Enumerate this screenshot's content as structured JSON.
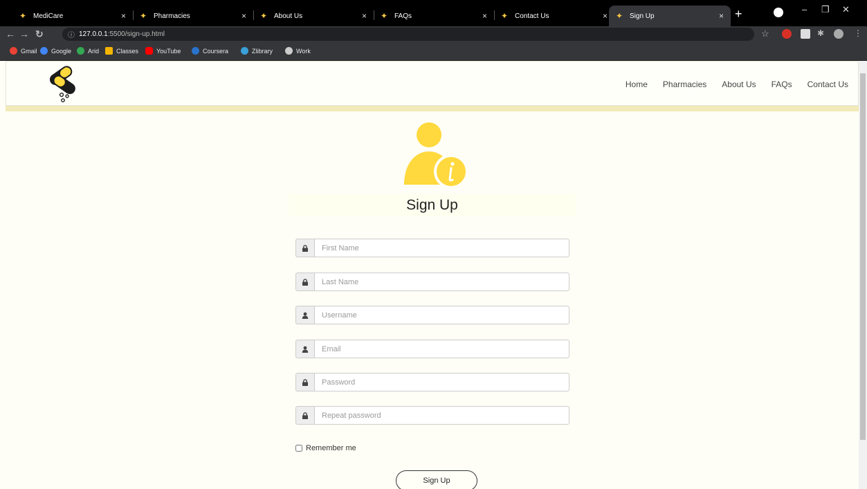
{
  "browser": {
    "tabs": [
      {
        "title": "MediCare",
        "active": false
      },
      {
        "title": "Pharmacies",
        "active": false
      },
      {
        "title": "About Us",
        "active": false
      },
      {
        "title": "FAQs",
        "active": false
      },
      {
        "title": "Contact Us",
        "active": false
      },
      {
        "title": "Sign Up",
        "active": true
      }
    ],
    "tab_close_glyph": "×",
    "new_tab_glyph": "+",
    "url": {
      "host": "127.0.0.1",
      "rest": ":5500/sign-up.html"
    },
    "bookmarks": [
      {
        "label": "Gmail",
        "color": "#ea4335"
      },
      {
        "label": "Google",
        "color": "#4285f4"
      },
      {
        "label": "Arid",
        "color": "#34a853"
      },
      {
        "label": "Classes",
        "color": "#f4b400"
      },
      {
        "label": "YouTube",
        "color": "#ff0000"
      },
      {
        "label": "Coursera",
        "color": "#2a73cc"
      },
      {
        "label": "Zlibrary",
        "color": "#3aa0d8"
      },
      {
        "label": "Work",
        "color": "#cccccc"
      }
    ]
  },
  "nav": {
    "items": [
      "Home",
      "Pharmacies",
      "About Us",
      "FAQs",
      "Contact Us"
    ]
  },
  "form": {
    "title": "Sign Up",
    "fields": [
      {
        "placeholder": "First Name",
        "icon": "lock-icon"
      },
      {
        "placeholder": "Last Name",
        "icon": "lock-icon"
      },
      {
        "placeholder": "Username",
        "icon": "user-icon"
      },
      {
        "placeholder": "Email",
        "icon": "user-icon"
      },
      {
        "placeholder": "Password",
        "icon": "lock-icon"
      },
      {
        "placeholder": "Repeat password",
        "icon": "lock-icon"
      }
    ],
    "remember_label": "Remember me",
    "submit_label": "Sign Up"
  },
  "colors": {
    "accent": "#ffd93d",
    "page_bg": "#fefef6",
    "header_band": "#f2eab8"
  }
}
